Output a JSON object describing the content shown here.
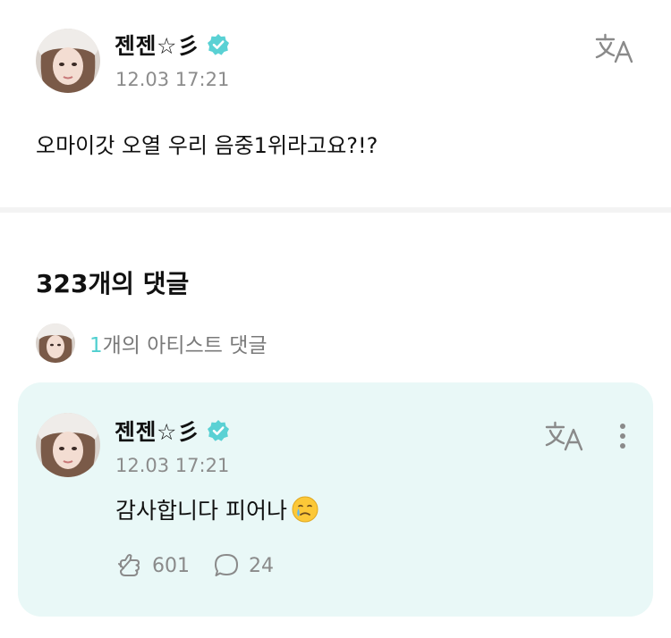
{
  "post": {
    "author": "젠젠☆彡",
    "timestamp": "12.03 17:21",
    "body": "오마이갓 오열 우리 음중1위라고요?!?",
    "translate_icon": "translate-icon"
  },
  "comments_header": {
    "label": "323개의 댓글"
  },
  "artist_comments": {
    "count": "1",
    "label": "개의 아티스트 댓글"
  },
  "comment": {
    "author": "젠젠☆彡",
    "timestamp": "12.03 17:21",
    "body": "감사합니다 피어나",
    "emoji": "crying-face-emoji",
    "likes": "601",
    "replies": "24"
  },
  "colors": {
    "accent": "#4fcfcf",
    "card_bg": "#e9f8f7",
    "verified": "#5ad1d4",
    "muted": "#8c8c8c"
  }
}
